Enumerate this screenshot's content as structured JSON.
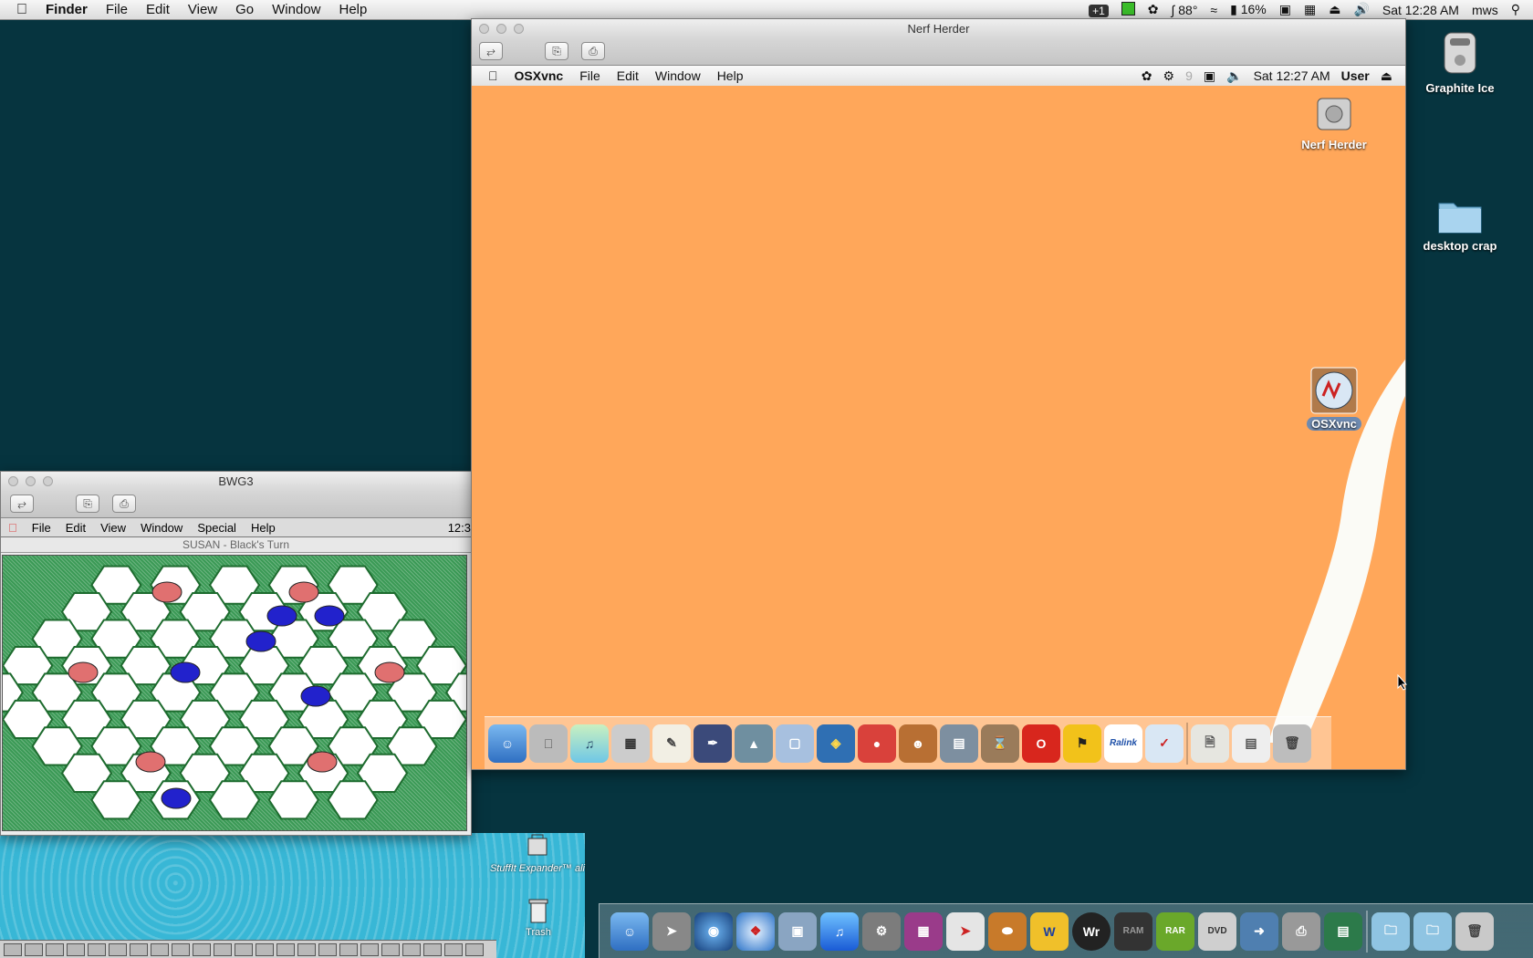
{
  "menubar": {
    "app": "Finder",
    "items": [
      "File",
      "Edit",
      "View",
      "Go",
      "Window",
      "Help"
    ],
    "status": {
      "badge": "1",
      "temp": "88°",
      "cpu": "16%",
      "clock": "Sat 12:28 AM",
      "user": "mws"
    }
  },
  "desktop": {
    "icons": [
      {
        "label": "Graphite Ice"
      },
      {
        "label": "desktop crap"
      }
    ]
  },
  "vnc_window": {
    "title": "Nerf Herder",
    "menubar": {
      "app": "OSXvnc",
      "items": [
        "File",
        "Edit",
        "Window",
        "Help"
      ],
      "clock": "Sat 12:27 AM",
      "user": "User"
    },
    "desktop_icons": [
      {
        "label": "Nerf Herder"
      },
      {
        "label": "OSXvnc"
      }
    ],
    "dock_labels": {
      "ralink": "Ralink"
    }
  },
  "bwg_window": {
    "title": "BWG3",
    "menubar": {
      "items": [
        "File",
        "Edit",
        "View",
        "Window",
        "Special",
        "Help"
      ],
      "clock": "12:3"
    },
    "game_title": "SUSAN - Black's Turn"
  },
  "classic_desktop": {
    "stuffit_label": "StuffIt Expander™ ali",
    "trash_label": "Trash"
  },
  "main_dock": {
    "labels": {
      "word": "W",
      "writer": "Wr",
      "ram": "RAM",
      "rar": "RAR",
      "dvd": "DVD"
    }
  },
  "colors": {
    "desktop": "#06343f",
    "vnc_bg": "#ffa75a",
    "board_green": "#3b9a56",
    "red_piece": "#e07070",
    "blue_piece": "#2222cc"
  }
}
